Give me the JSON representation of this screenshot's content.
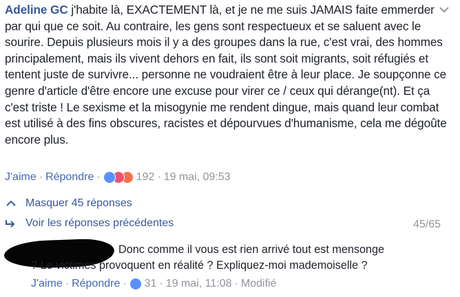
{
  "comment": {
    "author": "Adeline GC",
    "text": "j'habite là, EXACTEMENT là, et je ne me suis JAMAIS faite emmerder par qui que ce soit. Au contraire, les gens sont respectueux et se saluent avec le sourire. Depuis plusieurs mois il y a des groupes dans la rue, c'est vrai, des hommes principalement, mais ils vivent dehors en fait, ils sont soit migrants, soit réfugiés et tentent juste de survivre... personne ne voudraient être à leur place. Je soupçonne ce genre d'article d'être encore une excuse pour virer ce / ceux qui dérange(nt). Et ça c'est triste ! Le sexisme et la misogynie me rendent dingue, mais quand leur combat est utilisé à des fins obscures, racistes et dépourvues d'humanisme, cela me dégoûte encore plus.",
    "like_label": "J'aime",
    "reply_label": "Répondre",
    "separator": "·",
    "reaction_count": "192",
    "timestamp": "19 mai, 09:53",
    "reactions": [
      "like",
      "love",
      "angry"
    ]
  },
  "replies": {
    "hide_label": "Masquer 45 réponses",
    "previous_label": "Voir les réponses précédentes",
    "pager": "45/65"
  },
  "reply": {
    "line1": "Donc comme il vous est rien arrivé tout est mensonge",
    "line2": "? Le victimes provoquent en réalité ? Expliquez-moi mademoiselle ?",
    "like_label": "J'aime",
    "reply_label": "Répondre",
    "separator": "·",
    "reaction_count": "31",
    "timestamp": "19 mai, 11:08",
    "edited_label": "Modifié",
    "reactions": [
      "like"
    ]
  },
  "colors": {
    "link": "#365899",
    "action": "#4267b2",
    "meta": "#90949c",
    "text": "#1d2129"
  }
}
